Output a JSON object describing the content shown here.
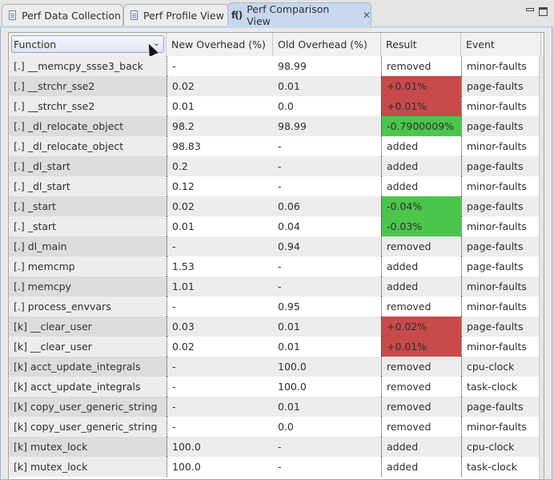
{
  "tabs": [
    {
      "label": "Perf Data Collection",
      "icon": "document-icon",
      "active": false
    },
    {
      "label": "Perf Profile View",
      "icon": "document-icon",
      "active": false
    },
    {
      "label": "Perf Comparison View",
      "icon": "function-icon",
      "active": true
    }
  ],
  "window_controls": {
    "minimize": "minimize-icon",
    "maximize": "maximize-icon"
  },
  "table": {
    "first_column_selector": "Function",
    "headers": [
      "New Overhead (%)",
      "Old Overhead (%)",
      "Result",
      "Event"
    ],
    "colors": {
      "increase": "#c84b4b",
      "decrease": "#4cc54c"
    },
    "rows": [
      {
        "function": "[.] __memcpy_ssse3_back",
        "new": "-",
        "old": "98.99",
        "result": "removed",
        "result_status": "none",
        "event": "minor-faults"
      },
      {
        "function": "[.] __strchr_sse2",
        "new": "0.02",
        "old": "0.01",
        "result": "+0.01%",
        "result_status": "increase",
        "event": "page-faults"
      },
      {
        "function": "[.] __strchr_sse2",
        "new": "0.01",
        "old": "0.0",
        "result": "+0.01%",
        "result_status": "increase",
        "event": "minor-faults"
      },
      {
        "function": "[.] _dl_relocate_object",
        "new": "98.2",
        "old": "98.99",
        "result": "-0.7900009%",
        "result_status": "decrease",
        "event": "page-faults"
      },
      {
        "function": "[.] _dl_relocate_object",
        "new": "98.83",
        "old": "-",
        "result": "added",
        "result_status": "none",
        "event": "minor-faults"
      },
      {
        "function": "[.] _dl_start",
        "new": "0.2",
        "old": "-",
        "result": "added",
        "result_status": "none",
        "event": "page-faults"
      },
      {
        "function": "[.] _dl_start",
        "new": "0.12",
        "old": "-",
        "result": "added",
        "result_status": "none",
        "event": "minor-faults"
      },
      {
        "function": "[.] _start",
        "new": "0.02",
        "old": "0.06",
        "result": "-0.04%",
        "result_status": "decrease",
        "event": "page-faults"
      },
      {
        "function": "[.] _start",
        "new": "0.01",
        "old": "0.04",
        "result": "-0.03%",
        "result_status": "decrease",
        "event": "minor-faults"
      },
      {
        "function": "[.] dl_main",
        "new": "-",
        "old": "0.94",
        "result": "removed",
        "result_status": "none",
        "event": "page-faults"
      },
      {
        "function": "[.] memcmp",
        "new": "1.53",
        "old": "-",
        "result": "added",
        "result_status": "none",
        "event": "page-faults"
      },
      {
        "function": "[.] memcpy",
        "new": "1.01",
        "old": "-",
        "result": "added",
        "result_status": "none",
        "event": "minor-faults"
      },
      {
        "function": "[.] process_envvars",
        "new": "-",
        "old": "0.95",
        "result": "removed",
        "result_status": "none",
        "event": "minor-faults"
      },
      {
        "function": "[k] __clear_user",
        "new": "0.03",
        "old": "0.01",
        "result": "+0.02%",
        "result_status": "increase",
        "event": "page-faults"
      },
      {
        "function": "[k] __clear_user",
        "new": "0.02",
        "old": "0.01",
        "result": "+0.01%",
        "result_status": "increase",
        "event": "minor-faults"
      },
      {
        "function": "[k] acct_update_integrals",
        "new": "-",
        "old": "100.0",
        "result": "removed",
        "result_status": "none",
        "event": "cpu-clock"
      },
      {
        "function": "[k] acct_update_integrals",
        "new": "-",
        "old": "100.0",
        "result": "removed",
        "result_status": "none",
        "event": "task-clock"
      },
      {
        "function": "[k] copy_user_generic_string",
        "new": "-",
        "old": "0.01",
        "result": "removed",
        "result_status": "none",
        "event": "page-faults"
      },
      {
        "function": "[k] copy_user_generic_string",
        "new": "-",
        "old": "0.0",
        "result": "removed",
        "result_status": "none",
        "event": "minor-faults"
      },
      {
        "function": "[k] mutex_lock",
        "new": "100.0",
        "old": "-",
        "result": "added",
        "result_status": "none",
        "event": "cpu-clock"
      },
      {
        "function": "[k] mutex_lock",
        "new": "100.0",
        "old": "-",
        "result": "added",
        "result_status": "none",
        "event": "task-clock"
      }
    ]
  }
}
